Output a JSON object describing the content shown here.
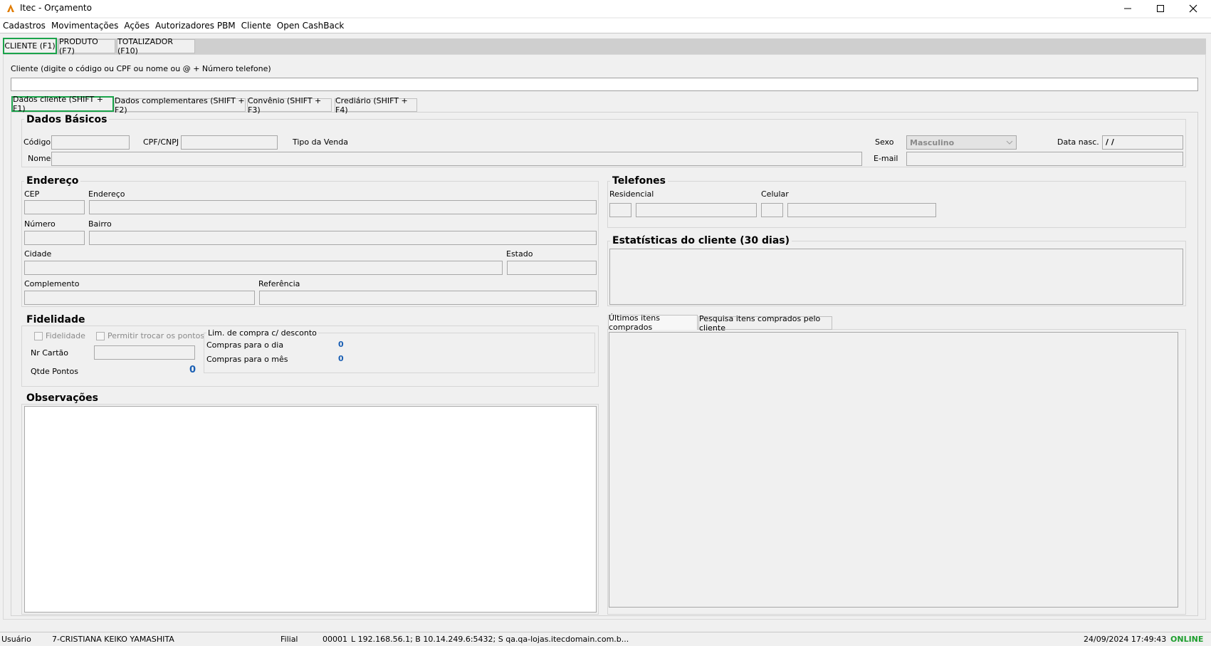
{
  "window": {
    "title": "Itec - Orçamento",
    "icon": "itec-logo-icon"
  },
  "menu": [
    "Cadastros",
    "Movimentações",
    "Ações",
    "Autorizadores PBM",
    "Cliente",
    "Open CashBack"
  ],
  "top_tabs": [
    "CLIENTE (F1)",
    "PRODUTO (F7)",
    "TOTALIZADOR (F10)"
  ],
  "cliente_search": {
    "label": "Cliente (digite o código ou CPF ou nome ou @ + Número telefone)",
    "value": ""
  },
  "sub_tabs": [
    "Dados cliente (SHIFT + F1)",
    "Dados complementares (SHIFT + F2)",
    "Convênio (SHIFT + F3)",
    "Crediário (SHIFT + F4)"
  ],
  "dados_basicos": {
    "title": "Dados Básicos",
    "codigo_label": "Código",
    "cpf_label": "CPF/CNPJ",
    "tipo_venda_label": "Tipo da Venda",
    "sexo_label": "Sexo",
    "sexo_value": "Masculino",
    "data_nasc_label": "Data nasc.",
    "data_nasc_value": " /  /",
    "nome_label": "Nome",
    "email_label": "E-mail"
  },
  "endereco": {
    "title": "Endereço",
    "cep_label": "CEP",
    "endereco_label": "Endereço",
    "numero_label": "Número",
    "bairro_label": "Bairro",
    "cidade_label": "Cidade",
    "estado_label": "Estado",
    "complemento_label": "Complemento",
    "referencia_label": "Referência"
  },
  "telefones": {
    "title": "Telefones",
    "residencial_label": "Residencial",
    "celular_label": "Celular"
  },
  "estatisticas": {
    "title": "Estatísticas do cliente  (30 dias)"
  },
  "fidelidade": {
    "title": "Fidelidade",
    "fidelidade_checkbox": "Fidelidade",
    "permitir_checkbox": "Permitir trocar os pontos",
    "nr_cartao_label": "Nr Cartão",
    "qtde_pontos_label": "Qtde Pontos",
    "qtde_pontos_value": "0",
    "lim_title": "Lim. de compra c/ desconto",
    "compras_dia_label": "Compras para o dia",
    "compras_dia_value": "0",
    "compras_mes_label": "Compras para o mês",
    "compras_mes_value": "0"
  },
  "observacoes": {
    "title": "Observações"
  },
  "itens_tabs": [
    "Últimos itens comprados",
    "Pesquisa itens comprados pelo cliente"
  ],
  "status": {
    "usuario_label": "Usuário",
    "usuario_value": "7-CRISTIANA KEIKO YAMASHITA",
    "filial_label": "Filial",
    "filial_value": "00001",
    "connection": "L 192.168.56.1; B 10.14.249.6:5432; S qa.qa-lojas.itecdomain.com.b...",
    "datetime": "24/09/2024 17:49:43",
    "online_prefix": "ON",
    "online_suffix": "LINE",
    "online_color": "#1e9e2e"
  }
}
